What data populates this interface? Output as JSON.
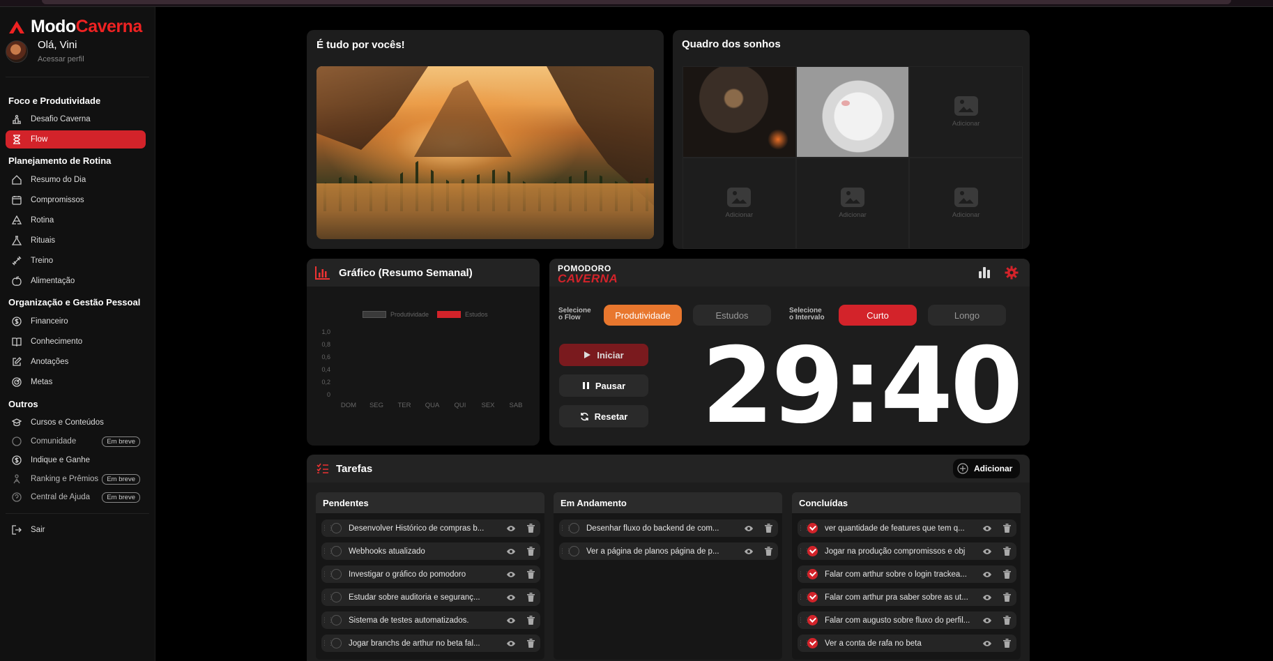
{
  "brand": {
    "part1": "Modo",
    "part2": "Caverna"
  },
  "user": {
    "greeting": "Olá, Vini",
    "profile_link": "Acessar perfil"
  },
  "sidebar": {
    "sections": [
      "Foco e Produtividade",
      "Planejamento de Rotina",
      "Organização e Gestão Pessoal",
      "Outros"
    ],
    "items": [
      {
        "label": "Desafio Caverna",
        "icon": "podium-icon"
      },
      {
        "label": "Flow",
        "icon": "hourglass-icon",
        "active": true
      },
      {
        "label": "Resumo do Dia",
        "icon": "home-icon"
      },
      {
        "label": "Compromissos",
        "icon": "calendar-icon"
      },
      {
        "label": "Rotina",
        "icon": "recycle-icon"
      },
      {
        "label": "Rituais",
        "icon": "flask-icon"
      },
      {
        "label": "Treino",
        "icon": "dumbbell-icon"
      },
      {
        "label": "Alimentação",
        "icon": "apple-icon"
      },
      {
        "label": "Financeiro",
        "icon": "dollar-icon"
      },
      {
        "label": "Conhecimento",
        "icon": "book-icon"
      },
      {
        "label": "Anotações",
        "icon": "edit-icon"
      },
      {
        "label": "Metas",
        "icon": "target-icon"
      },
      {
        "label": "Cursos e Conteúdos",
        "icon": "graduation-icon"
      },
      {
        "label": "Comunidade",
        "icon": "chat-icon",
        "badge": "Em breve"
      },
      {
        "label": "Indique e Ganhe",
        "icon": "dollar-icon"
      },
      {
        "label": "Ranking e Prêmios",
        "icon": "ranking-icon",
        "badge": "Em breve"
      },
      {
        "label": "Central de Ajuda",
        "icon": "help-icon",
        "badge": "Em breve"
      }
    ],
    "logout": "Sair"
  },
  "motivation": {
    "title": "É tudo por vocês!"
  },
  "dreams": {
    "title": "Quadro dos sonhos",
    "add_label": "Adicionar"
  },
  "weekly_chart": {
    "title": "Gráfico (Resumo Semanal)"
  },
  "chart_data": {
    "type": "bar",
    "categories": [
      "DOM",
      "SEG",
      "TER",
      "QUA",
      "QUI",
      "SEX",
      "SAB"
    ],
    "series": [
      {
        "name": "Produtividade",
        "values": [
          0,
          0,
          0,
          0,
          0,
          0,
          0
        ],
        "color": "#3a3a3a"
      },
      {
        "name": "Estudos",
        "values": [
          0,
          0,
          0,
          0,
          0,
          0,
          0
        ],
        "color": "#d3232a"
      }
    ],
    "yticks": [
      "1,0",
      "0,8",
      "0,6",
      "0,4",
      "0,2",
      "0"
    ],
    "ylim": [
      0,
      1
    ],
    "legend": "top-center",
    "grid": false
  },
  "pomodoro": {
    "logo_line1": "POMODORO",
    "logo_line2": "CAVERNA",
    "flow_label_1": "Selecione",
    "flow_label_2": "o Flow",
    "flow_options": [
      "Produtividade",
      "Estudos"
    ],
    "interval_label_1": "Selecione",
    "interval_label_2": "o Intervalo",
    "interval_options": [
      "Curto",
      "Longo"
    ],
    "start": "Iniciar",
    "pause": "Pausar",
    "reset": "Resetar",
    "time": "29:40",
    "accent_orange": "#e8772e",
    "accent_red": "#d3232a"
  },
  "tasks": {
    "title": "Tarefas",
    "add": "Adicionar",
    "columns": [
      {
        "title": "Pendentes",
        "done": false,
        "items": [
          "Desenvolver Histórico de compras b...",
          "Webhooks atualizado",
          "Investigar o gráfico do pomodoro",
          "Estudar sobre auditoria e seguranç...",
          "Sistema de testes automatizados.",
          "Jogar branchs de arthur no beta  fal..."
        ]
      },
      {
        "title": "Em Andamento",
        "done": false,
        "items": [
          "Desenhar fluxo do backend de com...",
          "Ver a página de planos página de  p..."
        ]
      },
      {
        "title": "Concluídas",
        "done": true,
        "items": [
          "ver quantidade de features que tem q...",
          "Jogar na produção compromissos  e obj",
          "Falar com arthur sobre o login trackea...",
          "Falar com arthur pra saber  sobre as ut...",
          "Falar com augusto sobre fluxo do perfil...",
          "Ver a conta de rafa no beta"
        ]
      }
    ]
  }
}
